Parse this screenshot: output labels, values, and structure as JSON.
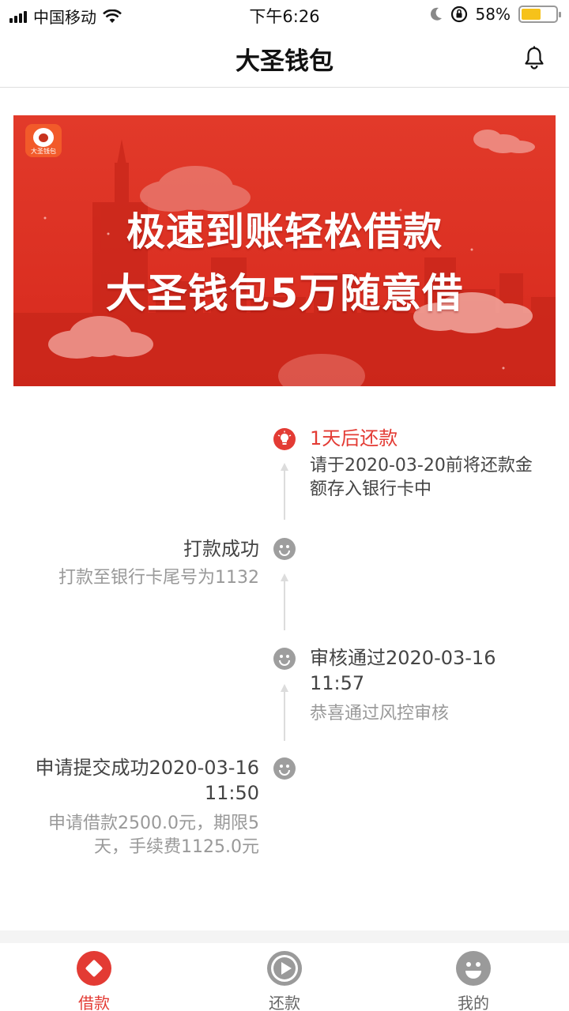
{
  "status_bar": {
    "carrier": "中国移动",
    "time": "下午6:26",
    "battery_text": "58%",
    "battery_level": 0.58,
    "battery_color": "#f6c21a"
  },
  "header": {
    "title": "大圣钱包",
    "icon": "bell-icon"
  },
  "banner": {
    "logo_text": "大圣钱包",
    "line1": "极速到账轻松借款",
    "line2": "大圣钱包5万随意借",
    "background": "#dc2f22"
  },
  "timeline": {
    "steps": [
      {
        "title": "1天后还款",
        "desc": "请于2020-03-20前将还款金额存入银行卡中",
        "icon": "lightbulb-icon",
        "accent": "#e33b34"
      },
      {
        "title": "打款成功",
        "desc": "打款至银行卡尾号为1132",
        "icon": "smiley-icon"
      },
      {
        "title": "审核通过2020-03-16 11:57",
        "desc": "恭喜通过风控审核",
        "icon": "smiley-icon"
      },
      {
        "title": "申请提交成功2020-03-16 11:50",
        "desc": "申请借款2500.0元，期限5天，手续费1125.0元",
        "icon": "smiley-icon"
      }
    ]
  },
  "bottom_nav": {
    "items": [
      {
        "label": "借款",
        "icon": "diamond-icon",
        "active": true
      },
      {
        "label": "还款",
        "icon": "play-icon",
        "active": false
      },
      {
        "label": "我的",
        "icon": "smiley-icon",
        "active": false
      }
    ],
    "active_color": "#e33b34",
    "inactive_color": "#9a9a9a"
  }
}
